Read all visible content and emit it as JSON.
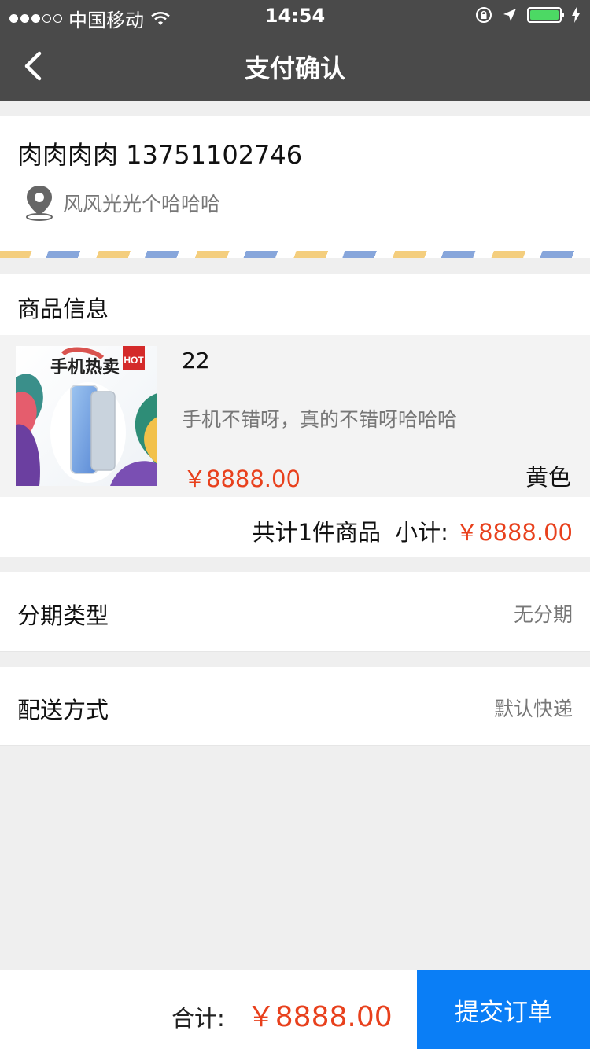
{
  "status_bar": {
    "carrier": "中国移动",
    "time": "14:54",
    "battery_level": 1.0,
    "colors": {
      "battery_fill": "#4cd964"
    }
  },
  "nav": {
    "back_icon": "chevron-left-icon",
    "title": "支付确认"
  },
  "address": {
    "name_phone": "肉肉肉肉 13751102746",
    "location_icon": "map-pin-icon",
    "detail": "风风光光个哈哈哈"
  },
  "goods": {
    "header": "商品信息",
    "item": {
      "image_badge": "HOT",
      "image_caption": "手机热卖",
      "name": "22",
      "desc": "手机不错呀，真的不错呀哈哈哈",
      "price": "￥8888.00",
      "color": "黄色"
    },
    "count_text": "共计1件商品",
    "subtotal_label": "小计:",
    "subtotal": "￥8888.00"
  },
  "installment": {
    "label": "分期类型",
    "value": "无分期"
  },
  "delivery": {
    "label": "配送方式",
    "value": "默认快递"
  },
  "footer": {
    "total_label": "合计:",
    "total": "￥8888.00",
    "submit_label": "提交订单"
  },
  "colors": {
    "header_bg": "#4a4a4a",
    "price_red": "#e8401c",
    "submit_blue": "#0a7ef6"
  }
}
